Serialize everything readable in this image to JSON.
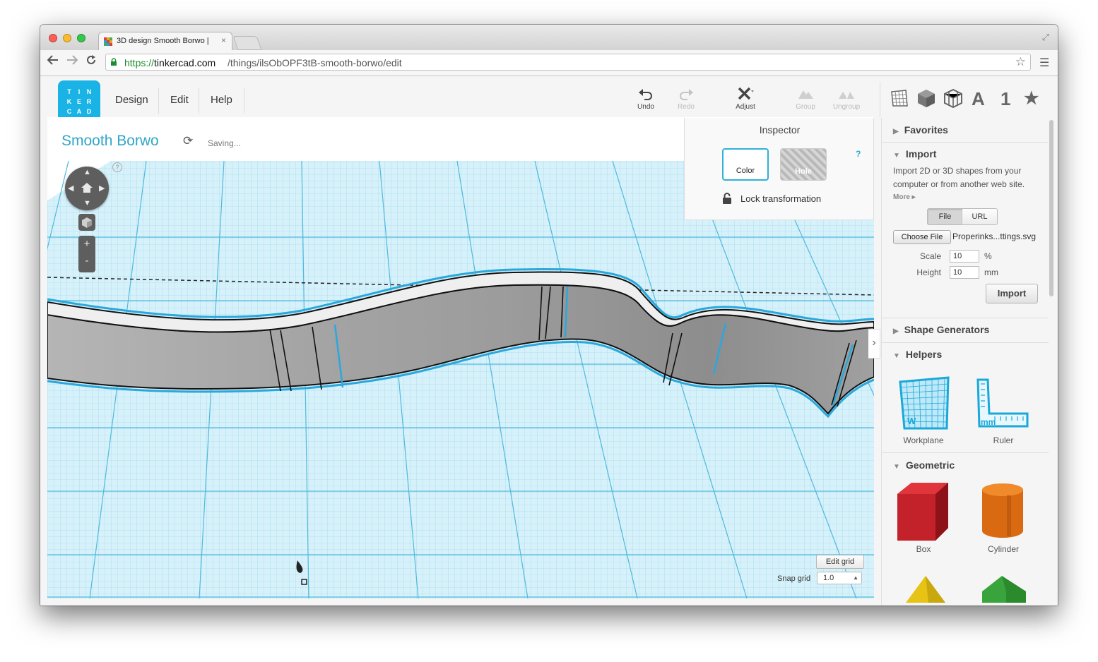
{
  "browser": {
    "tab_title": "3D design Smooth Borwo |",
    "tab_close": "×",
    "url_https": "https://",
    "url_domain": "tinkercad.com",
    "url_path": "/things/ilsObOPF3tB-smooth-borwo/edit",
    "nav_icons": [
      "back-arrow-icon",
      "forward-arrow-icon",
      "reload-icon"
    ],
    "traffic_light_colors": [
      "#fc5f57",
      "#fdbc2e",
      "#34c84a"
    ]
  },
  "app": {
    "logo_letters": [
      "T",
      "I",
      "N",
      "K",
      "E",
      "R",
      "C",
      "A",
      "D"
    ],
    "logo_color": "#19b4e5",
    "menu": [
      "Design",
      "Edit",
      "Help"
    ],
    "tools": {
      "undo": "Undo",
      "redo": "Redo",
      "adjust": "Adjust",
      "group": "Group",
      "ungroup": "Ungroup"
    },
    "panel_icons": {
      "letter": "A",
      "number": "1",
      "star": "★"
    }
  },
  "design": {
    "title": "Smooth Borwo",
    "status": "Saving..."
  },
  "inspector": {
    "title": "Inspector",
    "color_label": "Color",
    "hole_label": "Hole",
    "help": "?",
    "lock_label": "Lock transformation"
  },
  "grid_controls": {
    "edit_grid": "Edit grid",
    "snap_label": "Snap grid",
    "snap_value": "1.0"
  },
  "sidebar": {
    "favorites": "Favorites",
    "import": {
      "title": "Import",
      "description": "Import 2D or 3D shapes from your computer or from another web site.",
      "more": "More ▸",
      "tabs": [
        "File",
        "URL"
      ],
      "active_tab": "File",
      "choose_file": "Choose File",
      "file_name": "Properinks...ttings.svg",
      "scale_label": "Scale",
      "scale_value": "10",
      "scale_unit": "%",
      "height_label": "Height",
      "height_value": "10",
      "height_unit": "mm",
      "import_button": "Import"
    },
    "shape_generators": "Shape Generators",
    "helpers": {
      "title": "Helpers",
      "items": [
        "Workplane",
        "Ruler"
      ]
    },
    "geometric": {
      "title": "Geometric",
      "items": [
        "Box",
        "Cylinder"
      ]
    }
  }
}
